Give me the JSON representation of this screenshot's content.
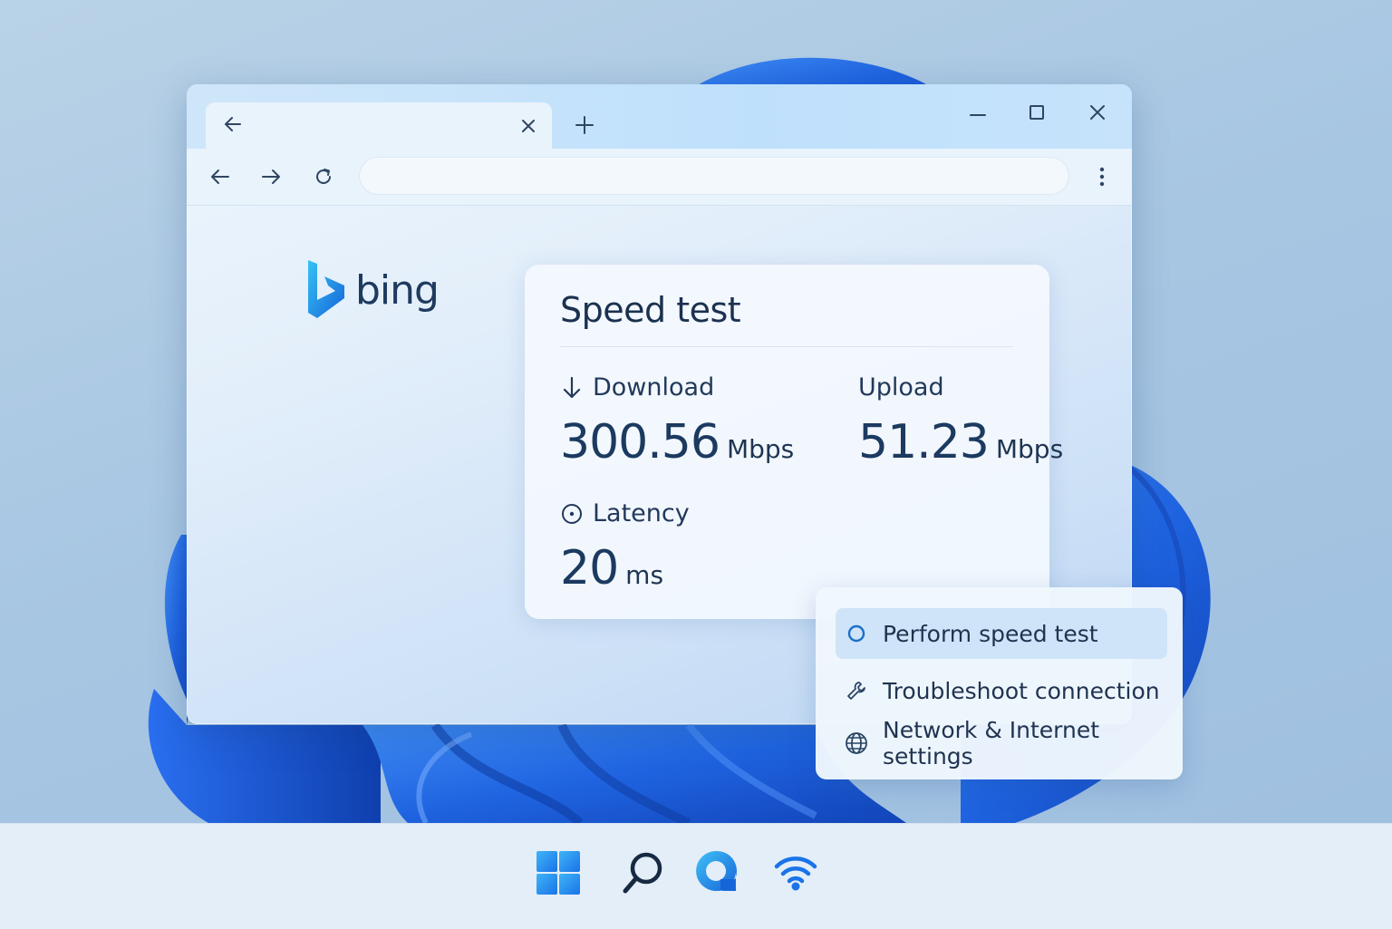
{
  "browser": {
    "tab": {
      "title": ""
    },
    "address": {
      "value": "",
      "placeholder": ""
    },
    "logo_text": "bing"
  },
  "speed_test": {
    "title": "Speed test",
    "download": {
      "label": "Download",
      "value": "300.56",
      "unit": "Mbps"
    },
    "upload": {
      "label": "Upload",
      "value": "51.23",
      "unit": "Mbps"
    },
    "latency": {
      "label": "Latency",
      "value": "20",
      "unit": "ms"
    }
  },
  "menu": {
    "items": [
      {
        "label": "Perform speed test",
        "icon": "circle-icon",
        "active": true
      },
      {
        "label": "Troubleshoot connection",
        "icon": "wrench-icon",
        "active": false
      },
      {
        "label": "Network & Internet settings",
        "icon": "globe-icon",
        "active": false
      }
    ]
  },
  "taskbar": {
    "icons": [
      "windows-start-icon",
      "search-icon",
      "copilot-icon",
      "wifi-icon"
    ]
  },
  "colors": {
    "accent": "#1a73e8",
    "bloom": "#1f63e0",
    "text": "#1e3552"
  }
}
